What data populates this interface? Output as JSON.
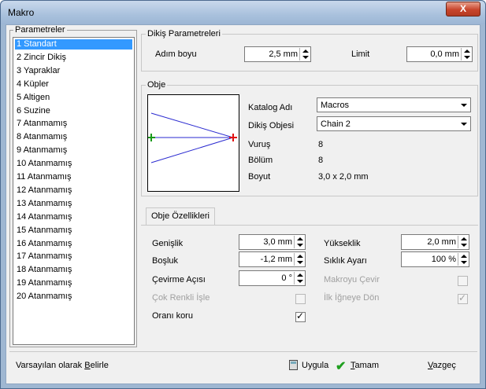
{
  "window": {
    "title": "Makro",
    "close_label": "X"
  },
  "params": {
    "legend": "Parametreler",
    "items": [
      "1  Standart",
      "2  Zincir Dikiş",
      "3  Yapraklar",
      "4  Küpler",
      "5  Altigen",
      "6  Suzine",
      "7  Atanmamış",
      "8  Atanmamış",
      "9  Atanmamış",
      "10 Atanmamış",
      "11 Atanmamış",
      "12 Atanmamış",
      "13 Atanmamış",
      "14 Atanmamış",
      "15 Atanmamış",
      "16 Atanmamış",
      "17 Atanmamış",
      "18 Atanmamış",
      "19 Atanmamış",
      "20 Atanmamış"
    ],
    "selected_index": 0
  },
  "stitch": {
    "legend": "Dikiş Parametreleri",
    "step_label": "Adım boyu",
    "step_value": "2,5 mm",
    "limit_label": "Limit",
    "limit_value": "0,0 mm"
  },
  "object": {
    "legend": "Obje",
    "catalog_label": "Katalog Adı",
    "catalog_value": "Macros",
    "stitch_object_label": "Dikiş Objesi",
    "stitch_object_value": "Chain 2",
    "stitches_label": "Vuruş",
    "stitches_value": "8",
    "segments_label": "Bölüm",
    "segments_value": "8",
    "size_label": "Boyut",
    "size_value": "3,0 x 2,0 mm"
  },
  "props": {
    "tab_label": "Obje Özellikleri",
    "width_label": "Genişlik",
    "width_value": "3,0 mm",
    "height_label": "Yükseklik",
    "height_value": "2,0 mm",
    "gap_label": "Boşluk",
    "gap_value": "-1,2 mm",
    "density_label": "Sıklık Ayarı",
    "density_value": "100 %",
    "rotate_label": "Çevirme Açısı",
    "rotate_value": "0 °",
    "flip_label": "Makroyu Çevir",
    "multicolor_label": "Çok Renkli İşle",
    "return_label": "İlk İğneye Dön",
    "ratio_label": "Oranı koru",
    "flip_checked": false,
    "multicolor_checked": false,
    "return_checked": true,
    "ratio_checked": true
  },
  "footer": {
    "set_default_prefix": "Varsayılan olarak ",
    "set_default_u": "B",
    "set_default_suffix": "elirle",
    "apply_label": "Uygula",
    "ok_u": "T",
    "ok_suffix": "amam",
    "cancel_u": "V",
    "cancel_suffix": "azgeç"
  }
}
